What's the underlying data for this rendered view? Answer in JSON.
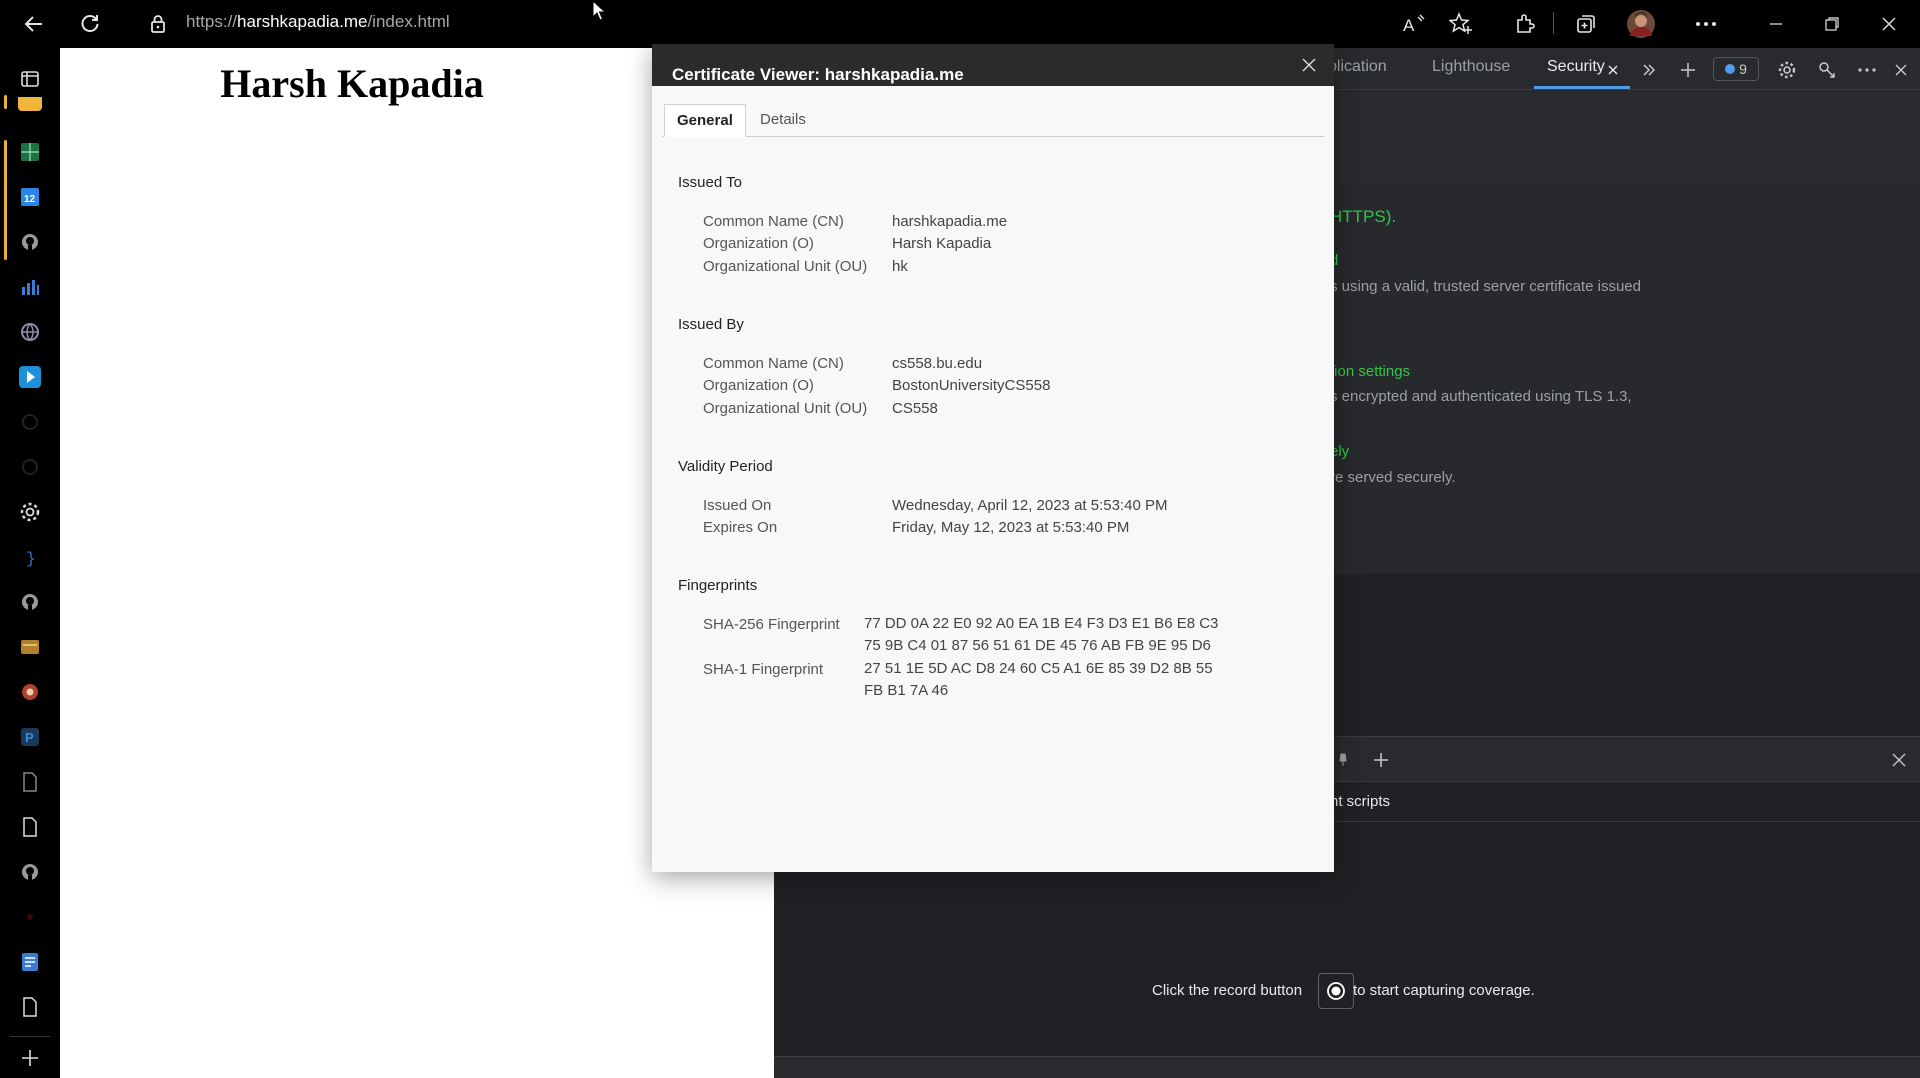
{
  "browser": {
    "url_prefix": "https://",
    "url_host": "harshkapadia.me",
    "url_path": "/index.html"
  },
  "page": {
    "heading": "Harsh Kapadia"
  },
  "devtools": {
    "tabs": [
      {
        "label": "plication"
      },
      {
        "label": "Lighthouse"
      },
      {
        "label": "Security"
      }
    ],
    "issues_count": "9",
    "security": {
      "summary_tail": "HTTPS).",
      "cert_title_tail": "d",
      "cert_desc_tail": "s using a valid, trusted server certificate issued",
      "conn_title_tail": "tion settings",
      "conn_desc_tail": "s encrypted and authenticated using TLS 1.3,",
      "res_title_tail": "ely",
      "res_desc_tail": "re served securely."
    },
    "drawer": {
      "sub_label": "nt scripts",
      "message_before": "Click the record button",
      "message_after": "to start capturing coverage."
    }
  },
  "dialog": {
    "title": "Certificate Viewer: harshkapadia.me",
    "tabs": [
      "General",
      "Details"
    ],
    "issued_to": {
      "heading": "Issued To",
      "rows": [
        {
          "key": "Common Name (CN)",
          "value": "harshkapadia.me"
        },
        {
          "key": "Organization (O)",
          "value": "Harsh Kapadia"
        },
        {
          "key": "Organizational Unit (OU)",
          "value": "hk"
        }
      ]
    },
    "issued_by": {
      "heading": "Issued By",
      "rows": [
        {
          "key": "Common Name (CN)",
          "value": "cs558.bu.edu"
        },
        {
          "key": "Organization (O)",
          "value": "BostonUniversityCS558"
        },
        {
          "key": "Organizational Unit (OU)",
          "value": "CS558"
        }
      ]
    },
    "validity": {
      "heading": "Validity Period",
      "rows": [
        {
          "key": "Issued On",
          "value": "Wednesday, April 12, 2023 at 5:53:40 PM"
        },
        {
          "key": "Expires On",
          "value": "Friday, May 12, 2023 at 5:53:40 PM"
        }
      ]
    },
    "fingerprints": {
      "heading": "Fingerprints",
      "sha256_key": "SHA-256 Fingerprint",
      "sha256_line1": "77 DD 0A 22 E0 92 A0 EA 1B E4 F3 D3 E1 B6 E8 C3",
      "sha256_line2": "75 9B C4 01 87 56 51 61 DE 45 76 AB FB 9E 95 D6",
      "sha1_key": "SHA-1 Fingerprint",
      "sha1_line1": "27 51 1E 5D AC D8 24 60 C5 A1 6E 85 39 D2 8B 55",
      "sha1_line2": "FB B1 7A 46"
    }
  },
  "colors": {
    "accent_blue": "#4d9dea",
    "secure_green": "#30c748",
    "sidebar_active": "#e8b339"
  }
}
